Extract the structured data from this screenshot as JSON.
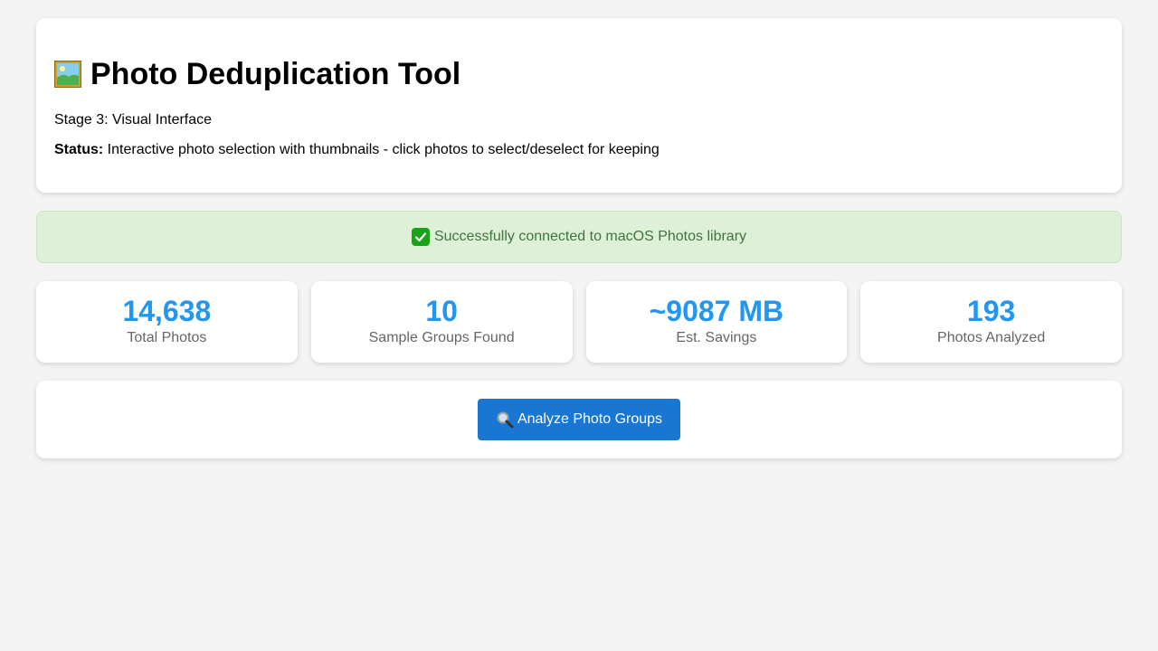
{
  "header": {
    "icon": "framed-picture-icon",
    "title": "Photo Deduplication Tool",
    "subtitle": "Stage 3: Visual Interface",
    "status_label": "Status:",
    "status_text": " Interactive photo selection with thumbnails - click photos to select/deselect for keeping"
  },
  "alert": {
    "icon": "check-mark-icon",
    "text": "Successfully connected to macOS Photos library",
    "color": "#3c763d",
    "background": "#dff0d8"
  },
  "stats": [
    {
      "value": "14,638",
      "label": "Total Photos"
    },
    {
      "value": "10",
      "label": "Sample Groups Found"
    },
    {
      "value": "~9087 MB",
      "label": "Est. Savings"
    },
    {
      "value": "193",
      "label": "Photos Analyzed"
    }
  ],
  "stat_value_color": "#2196f3",
  "action": {
    "icon": "magnifier-icon",
    "button_label": "Analyze Photo Groups",
    "button_color": "#1976d2"
  }
}
